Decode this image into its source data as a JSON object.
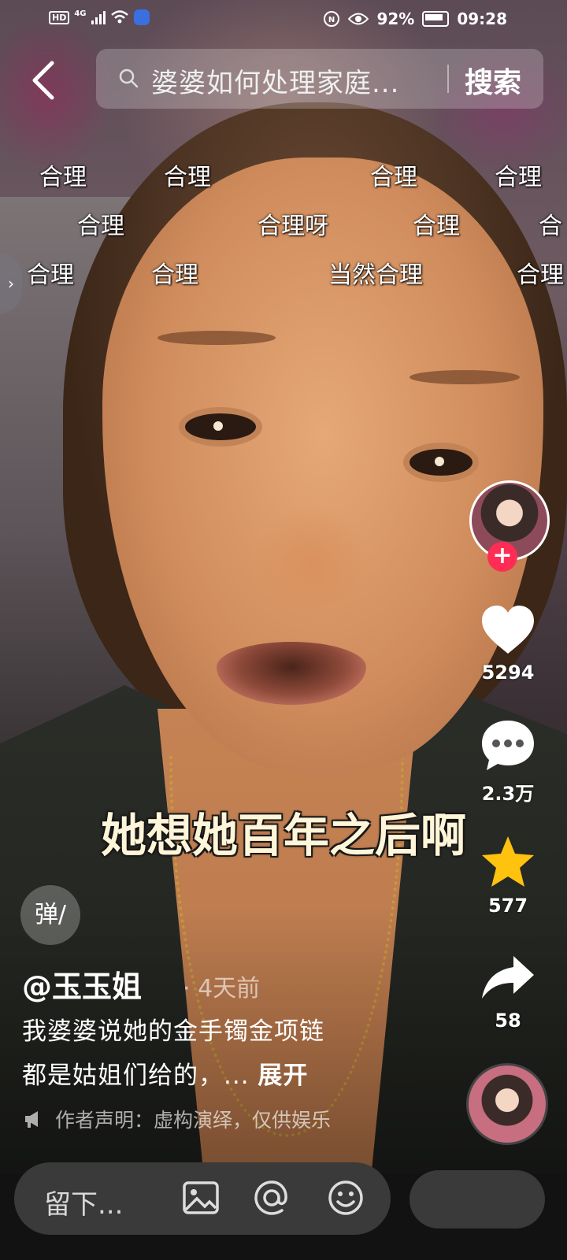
{
  "status_bar": {
    "hd": "HD",
    "network": "4G",
    "battery_percent": "92%",
    "time": "09:28",
    "icons": [
      "hd-icon",
      "signal-icon",
      "wifi-icon",
      "app-badge-icon",
      "nfc-icon",
      "eye-icon",
      "battery-icon"
    ]
  },
  "header": {
    "back_icon": "back-arrow-icon",
    "search_icon": "search-icon",
    "search_query": "婆婆如何处理家庭...",
    "search_button": "搜索"
  },
  "danmaku": [
    {
      "text": "合理"
    },
    {
      "text": "合理"
    },
    {
      "text": "合理"
    },
    {
      "text": "合理"
    },
    {
      "text": "合理"
    },
    {
      "text": "合理呀"
    },
    {
      "text": "合理"
    },
    {
      "text": "合"
    },
    {
      "text": "合理"
    },
    {
      "text": "合理"
    },
    {
      "text": "当然合理"
    },
    {
      "text": "合理"
    }
  ],
  "side_tab_glyph": "›",
  "subtitle": "她想她百年之后啊",
  "actions": {
    "follow_glyph": "+",
    "like_count": "5294",
    "comment_count": "2.3万",
    "favorite_count": "577",
    "share_count": "58",
    "colors": {
      "favorite": "#FFC20E",
      "follow": "#FF2D55"
    }
  },
  "danmu_toggle": "弹/",
  "author": "@玉玉姐",
  "post_time": "· 4天前",
  "description_line1": "我婆婆说她的金手镯金项链",
  "description_line2": "都是姑姐们给的，...",
  "expand_label": "展开",
  "notice": "作者声明：虚构演绎，仅供娱乐",
  "comment_bar": {
    "placeholder": "留下...",
    "image_icon": "image-icon",
    "mention_icon": "at-icon",
    "emoji_icon": "emoji-icon"
  }
}
